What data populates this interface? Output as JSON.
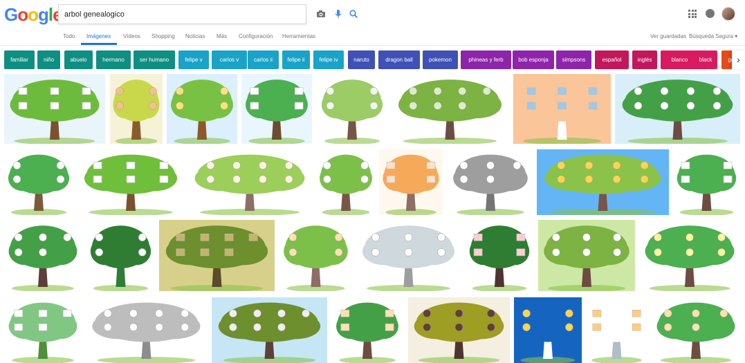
{
  "logo": {
    "text": "Google",
    "letters": [
      "G",
      "o",
      "o",
      "g",
      "l",
      "e"
    ],
    "colors": [
      "#4285F4",
      "#EA4335",
      "#FBBC05",
      "#4285F4",
      "#34A853",
      "#EA4335"
    ]
  },
  "search": {
    "query": "arbol genealogico"
  },
  "icons": {
    "camera": "camera-icon",
    "mic": "microphone-icon",
    "search": "search-icon",
    "apps": "apps-grid-icon",
    "notifications": "notifications-icon",
    "account": "avatar"
  },
  "tabs": [
    {
      "label": "Todo",
      "active": false
    },
    {
      "label": "Imágenes",
      "active": true
    },
    {
      "label": "Vídeos",
      "active": false
    },
    {
      "label": "Shopping",
      "active": false
    },
    {
      "label": "Noticias",
      "active": false
    },
    {
      "label": "Más",
      "active": false
    },
    {
      "label": "Configuración",
      "active": false
    },
    {
      "label": "Herramientas",
      "active": false
    }
  ],
  "right_tabs": [
    {
      "label": "Ver guardadas"
    },
    {
      "label": "Búsqueda Segura ▾"
    }
  ],
  "chips": [
    {
      "label": "familiar",
      "color": "#0f8f82"
    },
    {
      "label": "niño",
      "color": "#0f8f82"
    },
    {
      "label": "abuelo",
      "color": "#0f8f82"
    },
    {
      "label": "hermano",
      "color": "#0f8f82"
    },
    {
      "label": "ser humano",
      "color": "#0f8f82"
    },
    {
      "label": "felipe v",
      "color": "#1aa3c8"
    },
    {
      "label": "carlos v",
      "color": "#1aa3c8"
    },
    {
      "label": "carlos ii",
      "color": "#1aa3c8"
    },
    {
      "label": "felipe ii",
      "color": "#1aa3c8"
    },
    {
      "label": "felipe iv",
      "color": "#1aa3c8"
    },
    {
      "label": "naruto",
      "color": "#3f51b5"
    },
    {
      "label": "dragon ball",
      "color": "#3f51b5"
    },
    {
      "label": "pokemon",
      "color": "#3f51b5"
    },
    {
      "label": "phineas y ferb",
      "color": "#8e24aa"
    },
    {
      "label": "bob esponja",
      "color": "#8e24aa"
    },
    {
      "label": "simpsons",
      "color": "#8e24aa"
    },
    {
      "label": "español",
      "color": "#c2185b"
    },
    {
      "label": "inglés",
      "color": "#c2185b"
    },
    {
      "label": "blanco",
      "color": "#d81b60"
    },
    {
      "label": "black",
      "color": "#d81b60"
    },
    {
      "label": "gen",
      "color": "#e64a19"
    }
  ],
  "images": [
    {
      "name": "tree-frames-white"
    },
    {
      "name": "tree-kids-portraits"
    },
    {
      "name": "mi-arbol-cartoon-kids"
    },
    {
      "name": "tree-round-canopy"
    },
    {
      "name": "mi-arbol-genealogico-hearts"
    },
    {
      "name": "wide-tree-labels"
    },
    {
      "name": "family-chart-orange"
    },
    {
      "name": "mi-arbol-familiar"
    },
    {
      "name": "tree-circles"
    },
    {
      "name": "tree-plaques"
    },
    {
      "name": "tree-photo-frames"
    },
    {
      "name": "tree-medallions"
    },
    {
      "name": "tree-flowers-orange"
    },
    {
      "name": "sketch-tree-gray"
    },
    {
      "name": "simpsons-family-tree"
    },
    {
      "name": "tree-name-tags"
    },
    {
      "name": "tree-blue-labels"
    },
    {
      "name": "tree-swirl-leaves"
    },
    {
      "name": "tree-large-canopy-photos"
    },
    {
      "name": "tree-couples-faces"
    },
    {
      "name": "tree-empty-boxes"
    },
    {
      "name": "tree-red-circles"
    },
    {
      "name": "mi-arbol-genealogico-chart"
    },
    {
      "name": "tree-cartoon-family"
    },
    {
      "name": "tree-green-sketch"
    },
    {
      "name": "tree-sketch-frames"
    },
    {
      "name": "tree-wooden-sign"
    },
    {
      "name": "tree-faces-circles"
    },
    {
      "name": "tree-dark-leaves-signs"
    },
    {
      "name": "family-grid-blue"
    },
    {
      "name": "family-faces-chart"
    },
    {
      "name": "tree-small-photos"
    }
  ],
  "colors": {
    "accent": "#1a73e8",
    "tab_text": "#777777"
  }
}
